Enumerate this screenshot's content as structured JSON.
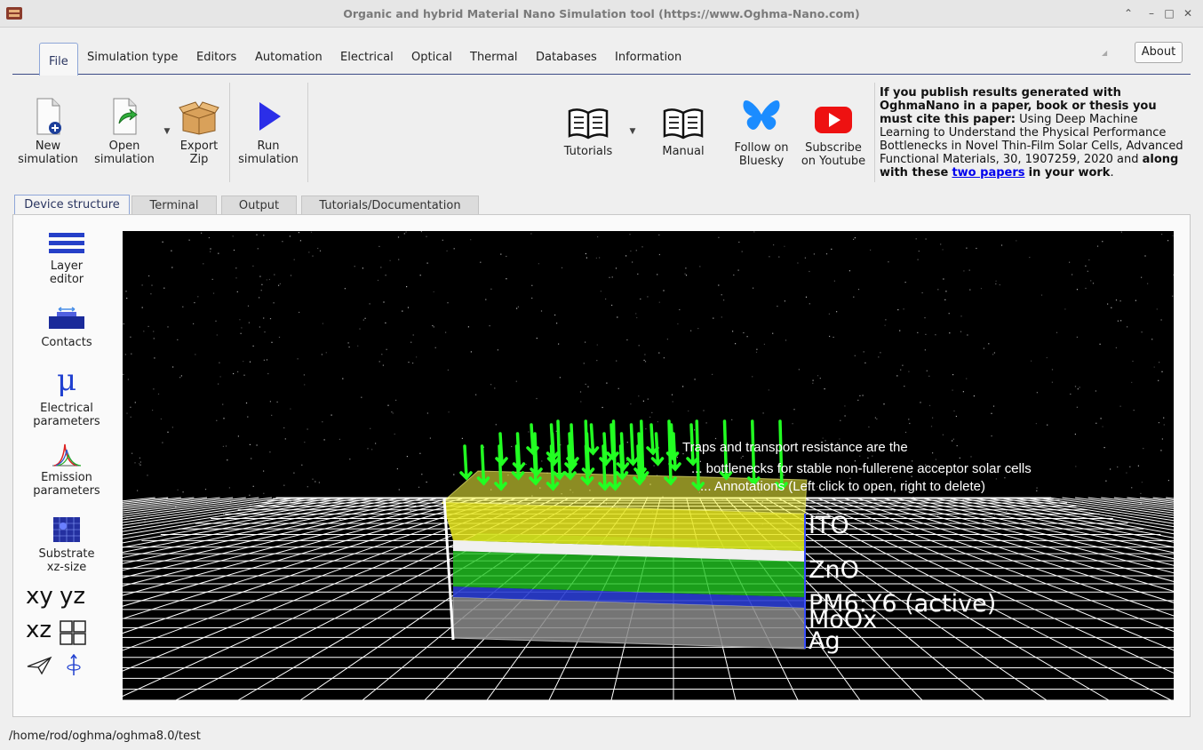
{
  "window": {
    "title": "Organic and hybrid Material Nano Simulation tool (https://www.Oghma-Nano.com)"
  },
  "menu": {
    "tabs": [
      {
        "label": "File"
      },
      {
        "label": "Simulation type"
      },
      {
        "label": "Editors"
      },
      {
        "label": "Automation"
      },
      {
        "label": "Electrical"
      },
      {
        "label": "Optical"
      },
      {
        "label": "Thermal"
      },
      {
        "label": "Databases"
      },
      {
        "label": "Information"
      }
    ],
    "about_label": "About"
  },
  "ribbon": {
    "new_simulation": [
      "New",
      "simulation"
    ],
    "open_simulation": [
      "Open",
      "simulation"
    ],
    "export_zip": [
      "Export",
      "Zip"
    ],
    "run_simulation": [
      "Run",
      "simulation"
    ],
    "tutorials": "Tutorials",
    "manual": "Manual",
    "follow_bluesky": [
      "Follow on",
      "Bluesky"
    ],
    "subscribe_youtube": [
      "Subscribe",
      "on Youtube"
    ],
    "cite": {
      "bold_intro": "If you publish results generated with OghmaNano in a paper, book or thesis you must cite this paper:",
      "paper": " Using Deep Machine Learning to Understand the Physical Performance Bottlenecks in Novel Thin-Film Solar Cells, Advanced Functional Materials, 30, 1907259, 2020 and ",
      "bold_along": "along with these",
      "link": "two papers",
      "bold_end": "in your work",
      "tail": "."
    }
  },
  "content_tabs": [
    {
      "label": "Device structure"
    },
    {
      "label": "Terminal"
    },
    {
      "label": "Output"
    },
    {
      "label": "Tutorials/Documentation"
    }
  ],
  "sidebar": {
    "layer_editor": [
      "Layer",
      "editor"
    ],
    "contacts": "Contacts",
    "electrical": [
      "Electrical",
      "parameters"
    ],
    "emission": [
      "Emission",
      "parameters"
    ],
    "substrate": [
      "Substrate",
      "xz-size"
    ],
    "view_xy": "xy",
    "view_yz": "yz",
    "view_xz": "xz",
    "mu_symbol": "μ"
  },
  "viewport": {
    "layers": [
      {
        "name": "ITO",
        "color": "#e8e820"
      },
      {
        "name": "ZnO",
        "color": "#ffffff"
      },
      {
        "name": "PM6:Y6 (active)",
        "color": "#22c522"
      },
      {
        "name": "MoOx",
        "color": "#2a3dd0"
      },
      {
        "name": "Ag",
        "color": "#8a8a8a"
      }
    ],
    "note_lines": [
      "Traps and transport resistance are the",
      "... bottlenecks for stable non-fullerene acceptor solar cells",
      "... Annotations (Left click to open, right to delete)"
    ],
    "arrow_color": "#22ff22"
  },
  "status": {
    "path": "/home/rod/oghma/oghma8.0/test"
  }
}
